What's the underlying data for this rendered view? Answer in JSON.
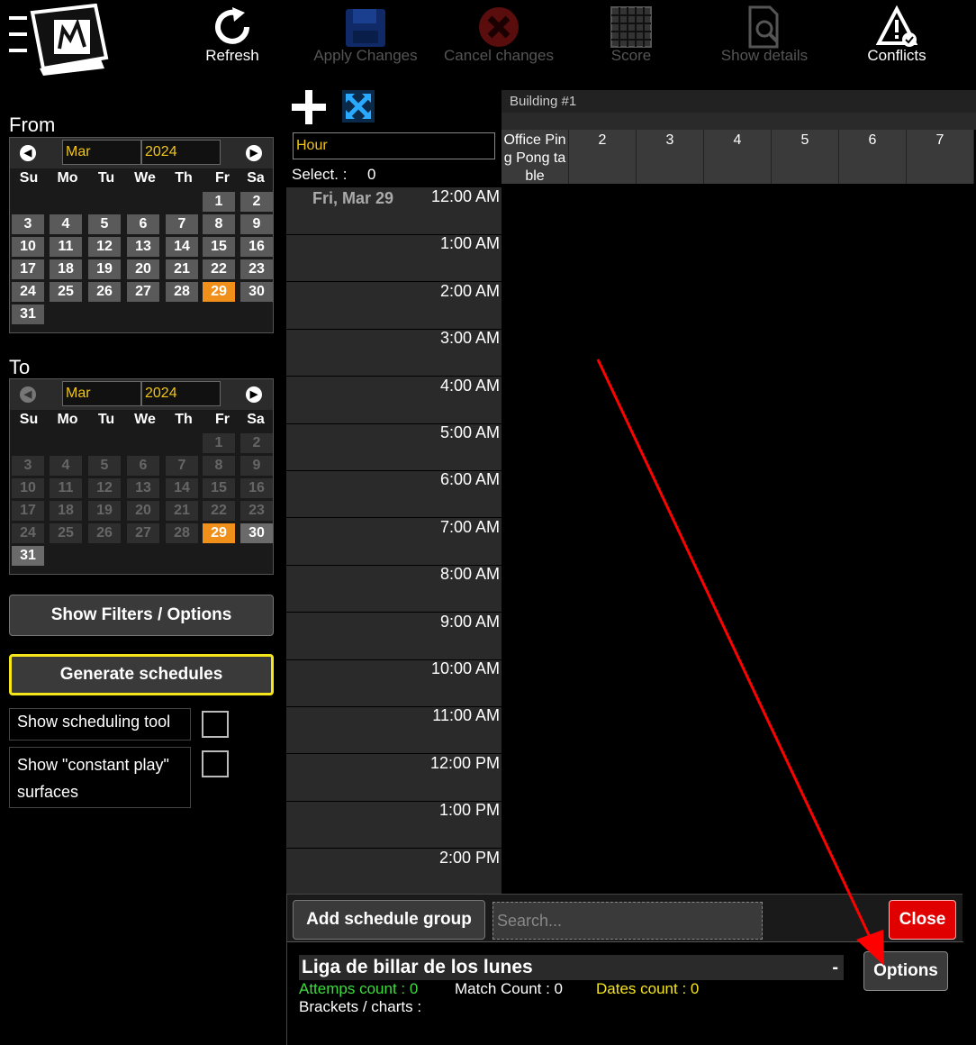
{
  "toolbar": {
    "refresh": "Refresh",
    "apply_changes": "Apply Changes",
    "cancel_changes": "Cancel changes",
    "score": "Score",
    "show_details": "Show details",
    "conflicts": "Conflicts"
  },
  "from_calendar": {
    "title": "From",
    "month": "Mar",
    "year": "2024",
    "weekdays": [
      "Su",
      "Mo",
      "Tu",
      "We",
      "Th",
      "Fr",
      "Sa"
    ],
    "selected_day": "29"
  },
  "to_calendar": {
    "title": "To",
    "month": "Mar",
    "year": "2024",
    "weekdays": [
      "Su",
      "Mo",
      "Tu",
      "We",
      "Th",
      "Fr",
      "Sa"
    ],
    "selected_day": "29"
  },
  "left_panel": {
    "show_filters": "Show Filters / Options",
    "generate": "Generate schedules",
    "show_scheduling_tool": "Show scheduling tool",
    "show_constant_play_1": "Show \"constant play\"",
    "show_constant_play_2": "surfaces"
  },
  "mid_tools": {
    "hour": "Hour",
    "select_label": "Select. :",
    "select_count": "0"
  },
  "schedule": {
    "date": "Fri, Mar 29",
    "times": [
      "12:00 AM",
      "1:00 AM",
      "2:00 AM",
      "3:00 AM",
      "4:00 AM",
      "5:00 AM",
      "6:00 AM",
      "7:00 AM",
      "8:00 AM",
      "9:00 AM",
      "10:00 AM",
      "11:00 AM",
      "12:00 PM",
      "1:00 PM",
      "2:00 PM"
    ]
  },
  "grid": {
    "building": "Building #1",
    "columns": [
      "Office Pin",
      "g Pong ta",
      "ble",
      "2",
      "3",
      "4",
      "5",
      "6",
      "7"
    ]
  },
  "bottom": {
    "add_group": "Add schedule group",
    "search_placeholder": "Search...",
    "close": "Close",
    "group_name": "Liga de billar de los lunes",
    "group_dash": "-",
    "attempts": "Attemps count : 0",
    "match_count": "Match Count : 0",
    "dates_count": "Dates count : 0",
    "brackets": "Brackets / charts :",
    "options": "Options"
  },
  "colors": {
    "accent_orange": "#f0901a",
    "highlight_yellow": "#f5e51b",
    "close_red": "#e00000",
    "arrow_red": "#ff0000"
  }
}
